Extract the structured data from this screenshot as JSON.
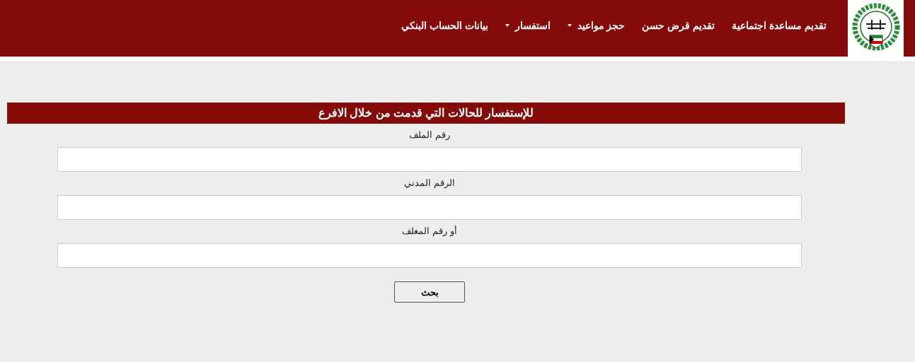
{
  "nav": {
    "items": [
      {
        "label": "تقديم مساعدة اجتماعية",
        "has_dropdown": false
      },
      {
        "label": "تقديم قرض حسن",
        "has_dropdown": false
      },
      {
        "label": "حجز مواعيد",
        "has_dropdown": true
      },
      {
        "label": "استفسار",
        "has_dropdown": true
      },
      {
        "label": "بيانات الحساب البنكي",
        "has_dropdown": false
      }
    ]
  },
  "form": {
    "title": "للإستفسار للحالات التي قدمت من خلال الافرع",
    "fields": [
      {
        "label": "رقم الملف"
      },
      {
        "label": "الرقم المدني"
      },
      {
        "label": "أو رقم المغلف"
      }
    ],
    "button": "بحث"
  }
}
